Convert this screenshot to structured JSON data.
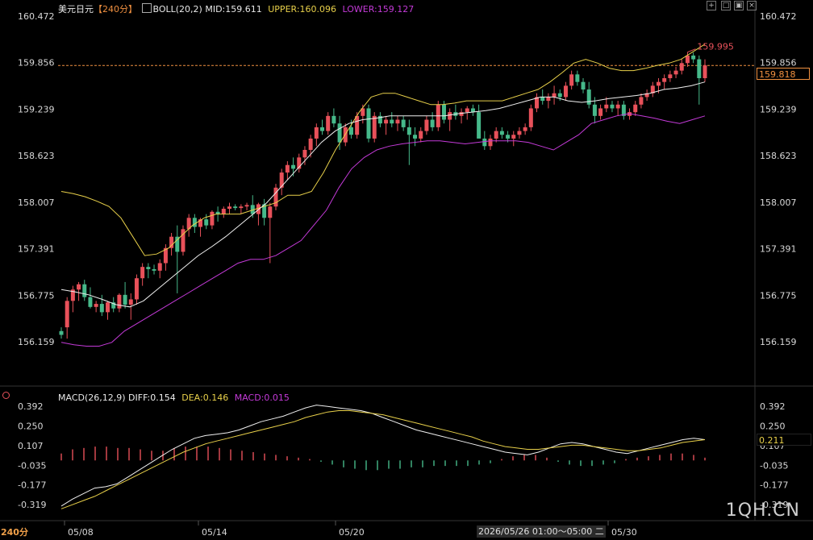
{
  "header": {
    "symbol": "美元日元",
    "period_tag": "【240分】",
    "boll_label": "BOLL(20,2)",
    "mid_label": "MID:159.611",
    "upper_label": "UPPER:160.096",
    "lower_label": "LOWER:159.127"
  },
  "macd_header": {
    "name": "MACD(26,12,9)",
    "diff_label": "DIFF:0.154",
    "dea_label": "DEA:0.146",
    "macd_label": "MACD:0.015"
  },
  "toolbar": {
    "icons": [
      "expand-icon",
      "square-icon",
      "window-icon",
      "close-icon"
    ]
  },
  "bottom_left_label": "240分",
  "crosshair_date": "2026/05/26 01:00～05:00 二",
  "brand": "1QH.CN",
  "current_price": "159.818",
  "current_macd": "0.211",
  "high_label": "159.995",
  "colors": {
    "up": "#e8515a",
    "down": "#46b98a",
    "upper": "#e8d04a",
    "mid": "#f0f0f0",
    "lower": "#c43ad8",
    "diff": "#f0f0f0",
    "dea": "#e8d04a",
    "accent": "#f09040",
    "grid": "#2a2a2a"
  },
  "chart_data": [
    {
      "type": "candlestick",
      "title": "美元日元 240分 BOLL(20,2)",
      "ylim": [
        156.159,
        160.472
      ],
      "y_ticks": [
        "160.472",
        "159.856",
        "159.239",
        "158.623",
        "158.007",
        "157.391",
        "156.775",
        "156.159"
      ],
      "x_labels": [
        "05/08",
        "05/14",
        "05/20",
        "05/30"
      ],
      "candles": [
        [
          156.3,
          156.35,
          156.2,
          156.25
        ],
        [
          156.35,
          156.75,
          156.2,
          156.7
        ],
        [
          156.7,
          156.9,
          156.55,
          156.85
        ],
        [
          156.85,
          156.95,
          156.7,
          156.92
        ],
        [
          156.92,
          156.98,
          156.7,
          156.75
        ],
        [
          156.75,
          156.88,
          156.6,
          156.62
        ],
        [
          156.62,
          156.7,
          156.55,
          156.66
        ],
        [
          156.66,
          156.78,
          156.5,
          156.55
        ],
        [
          156.55,
          156.7,
          156.45,
          156.68
        ],
        [
          156.68,
          156.75,
          156.55,
          156.6
        ],
        [
          156.6,
          156.8,
          156.55,
          156.78
        ],
        [
          156.78,
          156.95,
          156.6,
          156.65
        ],
        [
          156.65,
          156.8,
          156.45,
          156.72
        ],
        [
          156.72,
          157.05,
          156.65,
          157.0
        ],
        [
          157.0,
          157.2,
          156.9,
          157.15
        ],
        [
          157.15,
          157.2,
          157.0,
          157.12
        ],
        [
          157.12,
          157.18,
          157.05,
          157.1
        ],
        [
          157.1,
          157.25,
          157.0,
          157.2
        ],
        [
          157.2,
          157.45,
          157.1,
          157.4
        ],
        [
          157.4,
          157.6,
          157.3,
          157.55
        ],
        [
          157.55,
          157.7,
          156.8,
          157.35
        ],
        [
          157.35,
          157.7,
          157.3,
          157.65
        ],
        [
          157.65,
          157.85,
          157.55,
          157.8
        ],
        [
          157.8,
          157.85,
          157.6,
          157.68
        ],
        [
          157.68,
          157.8,
          157.55,
          157.78
        ],
        [
          157.78,
          157.85,
          157.65,
          157.7
        ],
        [
          157.7,
          157.9,
          157.65,
          157.88
        ],
        [
          157.88,
          157.95,
          157.75,
          157.85
        ],
        [
          157.85,
          157.95,
          157.8,
          157.92
        ],
        [
          157.92,
          158.0,
          157.85,
          157.95
        ],
        [
          157.95,
          157.98,
          157.9,
          157.93
        ],
        [
          157.93,
          157.98,
          157.85,
          157.95
        ],
        [
          157.95,
          158.0,
          157.9,
          157.97
        ],
        [
          157.97,
          158.1,
          157.8,
          157.85
        ],
        [
          157.85,
          158.0,
          157.7,
          157.98
        ],
        [
          157.98,
          158.05,
          157.7,
          157.8
        ],
        [
          157.8,
          158.0,
          157.2,
          157.95
        ],
        [
          157.95,
          158.25,
          157.9,
          158.2
        ],
        [
          158.2,
          158.45,
          158.1,
          158.4
        ],
        [
          158.4,
          158.55,
          158.3,
          158.5
        ],
        [
          158.5,
          158.6,
          158.35,
          158.45
        ],
        [
          158.45,
          158.65,
          158.4,
          158.6
        ],
        [
          158.6,
          158.75,
          158.5,
          158.7
        ],
        [
          158.7,
          158.9,
          158.6,
          158.85
        ],
        [
          158.85,
          159.05,
          158.75,
          159.0
        ],
        [
          159.0,
          159.1,
          158.9,
          158.95
        ],
        [
          158.95,
          159.2,
          158.9,
          159.15
        ],
        [
          159.15,
          159.25,
          159.0,
          159.05
        ],
        [
          159.05,
          159.15,
          158.7,
          158.8
        ],
        [
          158.8,
          159.05,
          158.75,
          159.0
        ],
        [
          159.0,
          159.1,
          158.85,
          158.9
        ],
        [
          158.9,
          159.2,
          158.85,
          159.15
        ],
        [
          159.15,
          159.3,
          159.05,
          159.25
        ],
        [
          159.25,
          159.3,
          158.8,
          158.85
        ],
        [
          158.85,
          159.2,
          158.8,
          159.15
        ],
        [
          159.15,
          159.2,
          159.0,
          159.05
        ],
        [
          159.05,
          159.15,
          158.9,
          159.1
        ],
        [
          159.1,
          159.2,
          159.0,
          159.05
        ],
        [
          159.05,
          159.15,
          158.95,
          159.1
        ],
        [
          159.1,
          159.15,
          158.95,
          159.0
        ],
        [
          159.0,
          159.1,
          158.5,
          158.9
        ],
        [
          158.9,
          159.0,
          158.75,
          158.85
        ],
        [
          158.85,
          159.0,
          158.8,
          158.95
        ],
        [
          158.95,
          159.15,
          158.9,
          159.1
        ],
        [
          159.1,
          159.2,
          158.95,
          159.0
        ],
        [
          159.0,
          159.35,
          158.95,
          159.3
        ],
        [
          159.3,
          159.35,
          159.05,
          159.1
        ],
        [
          159.1,
          159.25,
          158.95,
          159.2
        ],
        [
          159.2,
          159.3,
          159.1,
          159.15
        ],
        [
          159.15,
          159.25,
          159.05,
          159.2
        ],
        [
          159.2,
          159.28,
          159.1,
          159.25
        ],
        [
          159.25,
          159.3,
          159.15,
          159.2
        ],
        [
          159.2,
          159.3,
          159.1,
          158.85
        ],
        [
          158.85,
          158.95,
          158.7,
          158.75
        ],
        [
          158.75,
          158.9,
          158.7,
          158.85
        ],
        [
          158.85,
          159.0,
          158.8,
          158.95
        ],
        [
          158.95,
          159.0,
          158.85,
          158.9
        ],
        [
          158.9,
          158.95,
          158.8,
          158.85
        ],
        [
          158.85,
          158.95,
          158.75,
          158.9
        ],
        [
          158.9,
          159.0,
          158.85,
          158.95
        ],
        [
          158.95,
          159.05,
          158.9,
          159.0
        ],
        [
          159.0,
          159.3,
          158.95,
          159.25
        ],
        [
          159.25,
          159.45,
          159.2,
          159.4
        ],
        [
          159.4,
          159.5,
          159.3,
          159.35
        ],
        [
          159.35,
          159.45,
          159.25,
          159.4
        ],
        [
          159.4,
          159.55,
          159.3,
          159.45
        ],
        [
          159.45,
          159.5,
          159.35,
          159.4
        ],
        [
          159.4,
          159.6,
          159.35,
          159.55
        ],
        [
          159.55,
          159.75,
          159.5,
          159.7
        ],
        [
          159.7,
          159.75,
          159.55,
          159.6
        ],
        [
          159.6,
          159.65,
          159.45,
          159.5
        ],
        [
          159.5,
          159.6,
          159.25,
          159.3
        ],
        [
          159.3,
          159.4,
          159.05,
          159.15
        ],
        [
          159.15,
          159.3,
          159.1,
          159.25
        ],
        [
          159.25,
          159.4,
          159.2,
          159.3
        ],
        [
          159.3,
          159.35,
          159.2,
          159.25
        ],
        [
          159.25,
          159.35,
          159.15,
          159.3
        ],
        [
          159.3,
          159.35,
          159.1,
          159.15
        ],
        [
          159.15,
          159.25,
          159.1,
          159.2
        ],
        [
          159.2,
          159.35,
          159.15,
          159.3
        ],
        [
          159.3,
          159.45,
          159.25,
          159.4
        ],
        [
          159.4,
          159.5,
          159.35,
          159.45
        ],
        [
          159.45,
          159.6,
          159.4,
          159.55
        ],
        [
          159.55,
          159.65,
          159.45,
          159.6
        ],
        [
          159.6,
          159.7,
          159.5,
          159.65
        ],
        [
          159.65,
          159.75,
          159.6,
          159.7
        ],
        [
          159.7,
          159.8,
          159.65,
          159.75
        ],
        [
          159.75,
          159.9,
          159.7,
          159.85
        ],
        [
          159.85,
          159.995,
          159.8,
          159.95
        ],
        [
          159.95,
          159.99,
          159.85,
          159.9
        ],
        [
          159.9,
          159.95,
          159.3,
          159.65
        ],
        [
          159.65,
          159.9,
          159.6,
          159.82
        ]
      ],
      "upper": [
        158.15,
        158.12,
        158.08,
        158.02,
        157.95,
        157.8,
        157.55,
        157.3,
        157.32,
        157.4,
        157.55,
        157.7,
        157.8,
        157.85,
        157.85,
        157.85,
        157.9,
        157.95,
        158.0,
        158.1,
        158.1,
        158.15,
        158.4,
        158.7,
        158.95,
        159.2,
        159.4,
        159.45,
        159.45,
        159.4,
        159.35,
        159.3,
        159.3,
        159.32,
        159.35,
        159.35,
        159.35,
        159.35,
        159.4,
        159.45,
        159.5,
        159.6,
        159.72,
        159.85,
        159.9,
        159.85,
        159.78,
        159.75,
        159.75,
        159.78,
        159.82,
        159.85,
        159.9,
        160.0,
        160.1
      ],
      "mid": [
        156.85,
        156.82,
        156.78,
        156.72,
        156.65,
        156.62,
        156.7,
        156.85,
        157.0,
        157.15,
        157.3,
        157.42,
        157.55,
        157.7,
        157.85,
        158.0,
        158.2,
        158.4,
        158.6,
        158.8,
        158.95,
        159.05,
        159.1,
        159.12,
        159.15,
        159.15,
        159.15,
        159.15,
        159.15,
        159.18,
        159.2,
        159.22,
        159.25,
        159.3,
        159.35,
        159.4,
        159.4,
        159.35,
        159.33,
        159.35,
        159.38,
        159.4,
        159.42,
        159.45,
        159.5,
        159.52,
        159.55,
        159.6
      ],
      "lower": [
        156.15,
        156.12,
        156.1,
        156.1,
        156.15,
        156.3,
        156.4,
        156.5,
        156.6,
        156.7,
        156.8,
        156.9,
        157.0,
        157.1,
        157.2,
        157.25,
        157.25,
        157.3,
        157.4,
        157.5,
        157.7,
        157.9,
        158.2,
        158.45,
        158.6,
        158.7,
        158.75,
        158.78,
        158.8,
        158.82,
        158.82,
        158.8,
        158.78,
        158.8,
        158.82,
        158.82,
        158.82,
        158.8,
        158.75,
        158.7,
        158.8,
        158.9,
        159.05,
        159.1,
        159.15,
        159.18,
        159.15,
        159.12,
        159.08,
        159.05,
        159.1,
        159.15
      ],
      "current_price": 159.818,
      "period_high": 159.995
    },
    {
      "type": "macd",
      "title": "MACD(26,12,9)",
      "ylim": [
        -0.319,
        0.392
      ],
      "y_ticks": [
        "0.392",
        "0.250",
        "0.107",
        "-0.035",
        "-0.177",
        "-0.319"
      ],
      "diff": [
        -0.33,
        -0.28,
        -0.24,
        -0.2,
        -0.19,
        -0.17,
        -0.12,
        -0.07,
        -0.02,
        0.03,
        0.08,
        0.12,
        0.16,
        0.18,
        0.19,
        0.2,
        0.22,
        0.25,
        0.28,
        0.3,
        0.32,
        0.35,
        0.38,
        0.4,
        0.39,
        0.38,
        0.37,
        0.36,
        0.34,
        0.31,
        0.28,
        0.25,
        0.22,
        0.2,
        0.18,
        0.16,
        0.14,
        0.12,
        0.1,
        0.08,
        0.06,
        0.05,
        0.04,
        0.06,
        0.09,
        0.12,
        0.13,
        0.12,
        0.1,
        0.08,
        0.06,
        0.05,
        0.07,
        0.09,
        0.11,
        0.13,
        0.15,
        0.16,
        0.15
      ],
      "dea": [
        -0.35,
        -0.32,
        -0.29,
        -0.26,
        -0.22,
        -0.18,
        -0.14,
        -0.1,
        -0.06,
        -0.02,
        0.02,
        0.06,
        0.09,
        0.12,
        0.14,
        0.16,
        0.18,
        0.2,
        0.22,
        0.24,
        0.26,
        0.28,
        0.31,
        0.33,
        0.35,
        0.36,
        0.36,
        0.35,
        0.34,
        0.33,
        0.31,
        0.29,
        0.27,
        0.25,
        0.23,
        0.21,
        0.19,
        0.17,
        0.14,
        0.12,
        0.1,
        0.09,
        0.08,
        0.08,
        0.09,
        0.1,
        0.11,
        0.11,
        0.1,
        0.09,
        0.08,
        0.07,
        0.07,
        0.08,
        0.09,
        0.11,
        0.13,
        0.14,
        0.15
      ],
      "macd_hist": [
        0.05,
        0.08,
        0.09,
        0.1,
        0.1,
        0.09,
        0.09,
        0.08,
        0.07,
        0.07,
        0.09,
        0.1,
        0.1,
        0.1,
        0.09,
        0.08,
        0.07,
        0.06,
        0.05,
        0.04,
        0.03,
        0.02,
        0.01,
        -0.01,
        -0.03,
        -0.05,
        -0.06,
        -0.07,
        -0.07,
        -0.06,
        -0.06,
        -0.05,
        -0.05,
        -0.04,
        -0.04,
        -0.04,
        -0.04,
        -0.03,
        -0.02,
        0.01,
        0.03,
        0.04,
        0.04,
        0.02,
        -0.01,
        -0.03,
        -0.04,
        -0.04,
        -0.03,
        -0.02,
        0.01,
        0.02,
        0.03,
        0.04,
        0.05,
        0.05,
        0.04,
        0.02
      ],
      "current_value": 0.211
    }
  ]
}
